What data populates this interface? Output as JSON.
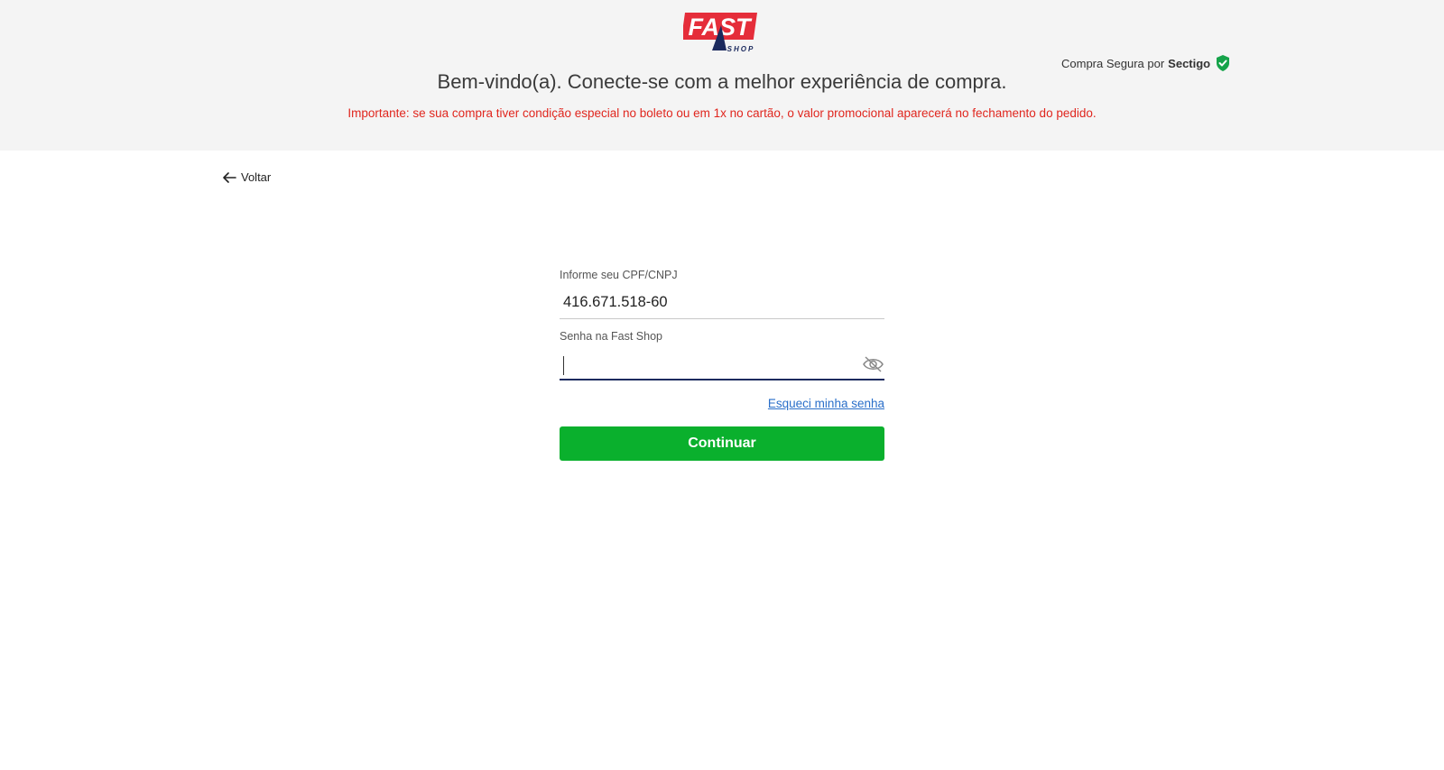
{
  "header": {
    "logo_text": "FAST",
    "logo_subtext": "SHOP",
    "welcome": "Bem-vindo(a). Conecte-se com a melhor experiência de compra.",
    "notice": "Importante: se sua compra tiver condição especial no boleto ou em 1x no cartão, o valor promocional aparecerá no fechamento do pedido.",
    "secure_text": "Compra Segura por",
    "secure_brand": "Sectigo"
  },
  "nav": {
    "back_label": "Voltar"
  },
  "form": {
    "cpf_label": "Informe seu CPF/CNPJ",
    "cpf_value": "416.671.518-60",
    "password_label": "Senha na Fast Shop",
    "password_value": "",
    "forgot_label": "Esqueci minha senha",
    "submit_label": "Continuar"
  },
  "colors": {
    "brand_red": "#e52d3a",
    "brand_navy": "#1b2a5e",
    "notice_red": "#e0261e",
    "button_green": "#0ab02d",
    "link_blue": "#2a6fc9",
    "shield_green": "#16a34a"
  },
  "icons": [
    "back-arrow-icon",
    "shield-check-icon",
    "eye-slash-icon"
  ]
}
